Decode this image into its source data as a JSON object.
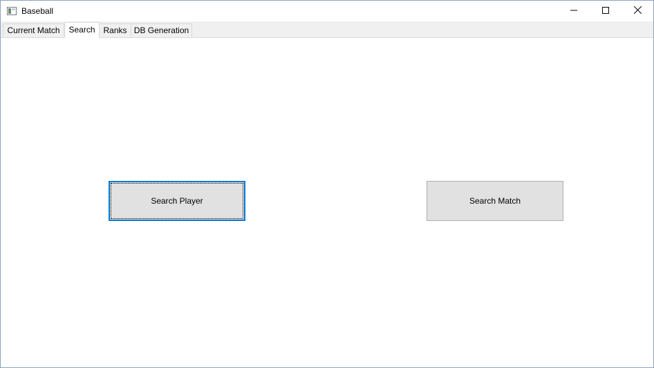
{
  "window": {
    "title": "Baseball",
    "icon": "app-window-icon",
    "controls": {
      "minimize_icon": "minimize-icon",
      "maximize_icon": "maximize-icon",
      "close_icon": "close-icon"
    }
  },
  "tabs": [
    {
      "label": "Current Match",
      "active": false
    },
    {
      "label": "Search",
      "active": true
    },
    {
      "label": "Ranks",
      "active": false
    },
    {
      "label": "DB Generation",
      "active": false
    }
  ],
  "search_panel": {
    "search_player_label": "Search Player",
    "search_match_label": "Search Match"
  },
  "colors": {
    "focus_border": "#0078d7",
    "button_face": "#e1e1e1",
    "tab_strip": "#f0f0f0"
  }
}
